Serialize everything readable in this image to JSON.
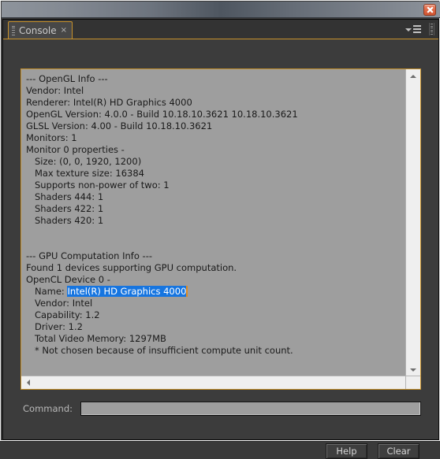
{
  "window": {
    "close_icon": "close-x-icon"
  },
  "tabbar": {
    "tab_label": "Console",
    "tab_close_glyph": "×",
    "menu_icon": "menu-dropdown-icon",
    "grip_icon": "grip-handle-icon"
  },
  "console": {
    "lines": [
      "--- OpenGL Info ---",
      "Vendor: Intel",
      "Renderer: Intel(R) HD Graphics 4000",
      "OpenGL Version: 4.0.0 - Build 10.18.10.3621 10.18.10.3621",
      "GLSL Version: 4.00 - Build 10.18.10.3621",
      "Monitors: 1",
      "Monitor 0 properties -",
      "   Size: (0, 0, 1920, 1200)",
      "   Max texture size: 16384",
      "   Supports non-power of two: 1",
      "   Shaders 444: 1",
      "   Shaders 422: 1",
      "   Shaders 420: 1",
      "",
      "",
      "--- GPU Computation Info ---",
      "Found 1 devices supporting GPU computation.",
      "OpenCL Device 0 -"
    ],
    "selected_line": {
      "prefix": "   Name: ",
      "selection": "Intel(R) HD Graphics 4000"
    },
    "lines_after": [
      "   Vendor: Intel",
      "   Capability: 1.2",
      "   Driver: 1.2",
      "   Total Video Memory: 1297MB",
      "   * Not chosen because of insufficient compute unit count."
    ],
    "selection_color": "#1675e0",
    "caret_color": "#e08a1e",
    "background_color": "#9e9e9e",
    "text_color": "#1a1a1a"
  },
  "scrollbars": {
    "vertical_up_icon": "scroll-up-arrow-icon",
    "vertical_down_icon": "scroll-down-arrow-icon",
    "horizontal_left_icon": "scroll-left-arrow-icon"
  },
  "command": {
    "label": "Command:",
    "value": "",
    "placeholder": ""
  },
  "buttons": {
    "help": "Help",
    "clear": "Clear"
  },
  "theme": {
    "accent": "#c8922b",
    "panel_bg": "#3c3c3c",
    "titlebar_dark": "#4e5660",
    "close_button": "#df6a48"
  }
}
